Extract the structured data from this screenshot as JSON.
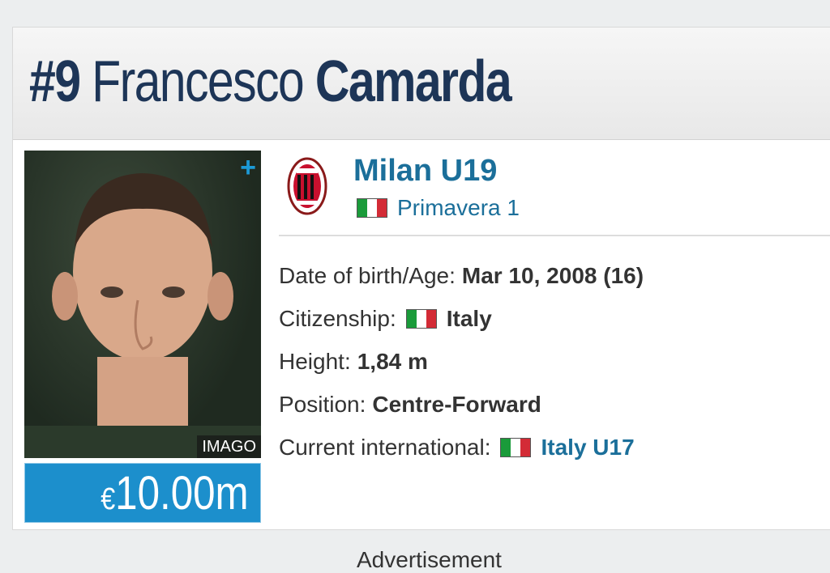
{
  "player": {
    "number": "#9",
    "first_name": "Francesco",
    "last_name": "Camarda",
    "photo_credit": "IMAGO",
    "plus_symbol": "+",
    "market_value": {
      "currency": "€",
      "amount": "10.00m"
    }
  },
  "club": {
    "name": "Milan U19",
    "logo_icon": "ac-milan-crest-icon",
    "league": "Primavera 1",
    "league_flag": "italy-flag-icon"
  },
  "info": {
    "dob_label": "Date of birth/Age:",
    "dob_value": "Mar 10, 2008 (16)",
    "citizenship_label": "Citizenship:",
    "citizenship_value": "Italy",
    "height_label": "Height:",
    "height_value": "1,84 m",
    "position_label": "Position:",
    "position_value": "Centre-Forward",
    "international_label": "Current international:",
    "international_value": "Italy U17"
  },
  "footer": {
    "advertisement": "Advertisement"
  },
  "colors": {
    "title": "#1d3557",
    "link": "#1b6f9a",
    "value_bg": "#1c8fcc",
    "plus": "#1c9ad6"
  }
}
